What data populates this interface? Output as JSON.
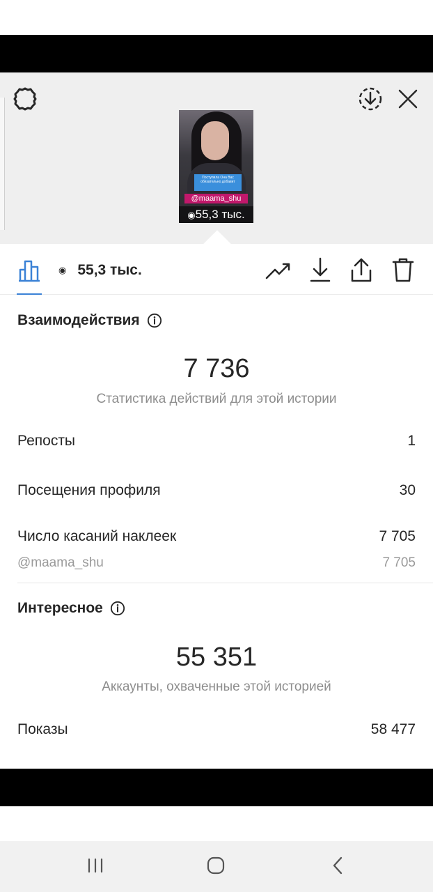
{
  "story": {
    "mention_label": "@maama_shu",
    "views_label": "55,3 тыс.",
    "sticker_text": "Поступила Она Вас обязательно добавит"
  },
  "toolbar": {
    "views_label": "55,3 тыс."
  },
  "interactions": {
    "title": "Взаимодействия",
    "total": "7 736",
    "caption": "Статистика действий для этой истории",
    "rows": [
      {
        "label": "Репосты",
        "value": "1"
      },
      {
        "label": "Посещения профиля",
        "value": "30"
      },
      {
        "label": "Число касаний наклеек",
        "value": "7 705"
      }
    ],
    "sub_row": {
      "label": "@maama_shu",
      "value": "7 705"
    }
  },
  "discovery": {
    "title": "Интересное",
    "total": "55 351",
    "caption": "Аккаунты, охваченные этой историей",
    "rows": [
      {
        "label": "Показы",
        "value": "58 477"
      }
    ]
  },
  "colors": {
    "accent": "#3b82d6",
    "mention": "#c2186b"
  }
}
